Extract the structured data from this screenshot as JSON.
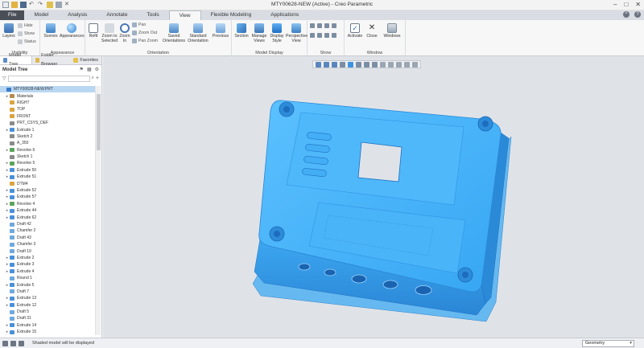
{
  "app": {
    "title": "MTY00628-NEW (Active) - Creo Parametric"
  },
  "tabs": [
    "File",
    "Model",
    "Analysis",
    "Annotate",
    "Tools",
    "View",
    "Flexible Modeling",
    "Applications"
  ],
  "active_tab": "View",
  "ribbon": {
    "visibility": {
      "label": "Visibility",
      "layers": "Layers",
      "hide": "Hide",
      "show": "Show",
      "status": "Status"
    },
    "appearance": {
      "label": "Appearance",
      "scenes": "Scenes",
      "appearances": "Appearances"
    },
    "orientation": {
      "label": "Orientation",
      "refit": "Refit",
      "zoom_to_selected": "Zoom to Selected",
      "zoom_in": "Zoom In",
      "pan": "Pan",
      "zoom_out": "Zoom Out",
      "pan_zoom": "Pan Zoom",
      "saved": "Saved Orientations",
      "standard": "Standard Orientation",
      "previous": "Previous"
    },
    "model_display": {
      "label": "Model Display",
      "section": "Section",
      "manage_views": "Manage Views",
      "display_style": "Display Style",
      "perspective": "Perspective View"
    },
    "show": {
      "label": "Show"
    },
    "window": {
      "label": "Window",
      "activate": "Activate",
      "close": "Close",
      "windows": "Windows"
    }
  },
  "panel": {
    "tabs": [
      "Model Tree",
      "Folder Browser",
      "Favorites"
    ],
    "title": "Model Tree",
    "tree": [
      "MTY00628-NEW.PRT",
      "Materials",
      "RIGHT",
      "TOP",
      "FRONT",
      "PRT_CSYS_DEF",
      "Extrude 1",
      "Sketch 2",
      "A_350",
      "Revolve 6",
      "Sketch 1",
      "Revolve 5",
      "Extrude 50",
      "Extrude 51",
      "DTM4",
      "Extrude 52",
      "Extrude 57",
      "Revolve 4",
      "Extrude 44",
      "Extrude 62",
      "Draft 42",
      "Chamfer 2",
      "Draft 43",
      "Chamfer 3",
      "Draft 19",
      "Extrude 2",
      "Extrude 3",
      "Extrude 4",
      "Round 1",
      "Extrude 5",
      "Draft 7",
      "Extrude 13",
      "Extrude 12",
      "Draft 5",
      "Draft 31",
      "Extrude 14",
      "Extrude 15"
    ]
  },
  "status": {
    "message": "Shaded model will be displayed",
    "filter": "Geometry"
  },
  "colors": {
    "model": "#3fb2f9",
    "model_dark": "#2a86d6",
    "background": "#dfe3e8",
    "accent": "#2d71c4"
  }
}
